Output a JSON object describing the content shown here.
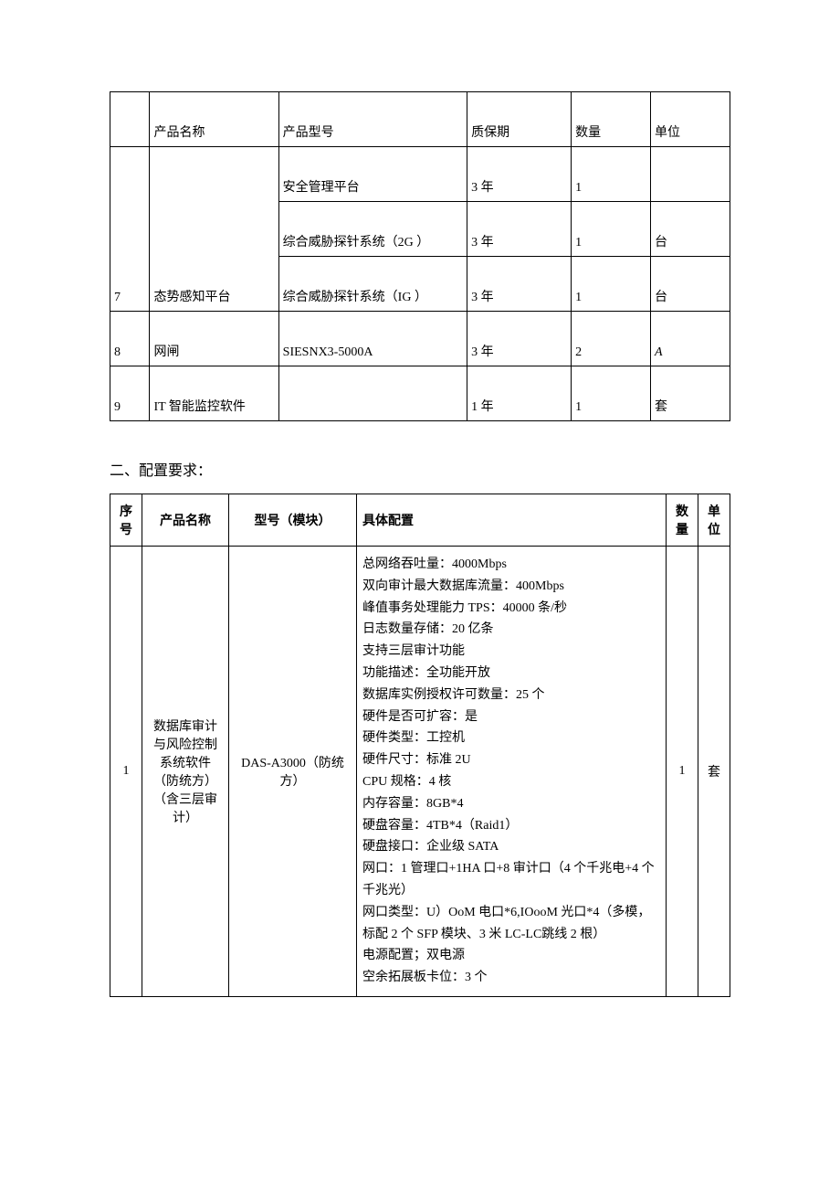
{
  "table1": {
    "headers": {
      "c0": "",
      "c1": "产品名称",
      "c2": "产品型号",
      "c3": "质保期",
      "c4": "数量",
      "c5": "单位"
    },
    "rows": [
      {
        "idx": "7",
        "name": "态势感知平台",
        "variants": [
          {
            "model": "安全管理平台",
            "warranty": "3 年",
            "qty": "1",
            "unit": ""
          },
          {
            "model": "综合威胁探针系统（2G ）",
            "warranty": "3 年",
            "qty": "1",
            "unit": "台"
          },
          {
            "model": "综合威胁探针系统（IG ）",
            "warranty": "3 年",
            "qty": "1",
            "unit": "台"
          }
        ]
      },
      {
        "idx": "8",
        "name": "网闸",
        "model": "SIESNX3-5000A",
        "warranty": "3 年",
        "qty": "2",
        "unit": "A"
      },
      {
        "idx": "9",
        "name": "IT 智能监控软件",
        "model": "",
        "warranty": "1 年",
        "qty": "1",
        "unit": "套"
      }
    ]
  },
  "section2": {
    "title": "二、配置要求：",
    "headers": {
      "c0": "序号",
      "c1": "产品名称",
      "c2": "型号（模块）",
      "c3": "具体配置",
      "c4": "数量",
      "c5": "单位"
    },
    "rows": [
      {
        "idx": "1",
        "name": "数据库审计与风险控制系统软件（防统方）（含三层审计）",
        "model": "DAS-A3000（防统方）",
        "spec": "总网络吞吐量：4000Mbps\n双向审计最大数据库流量：400Mbps\n峰值事务处理能力 TPS：40000 条/秒\n日志数量存储：20 亿条\n支持三层审计功能\n功能描述：全功能开放\n数据库实例授权许可数量：25 个\n硬件是否可扩容：是\n硬件类型：工控机\n硬件尺寸：标准 2U\nCPU 规格：4 核\n内存容量：8GB*4\n硬盘容量：4TB*4（Raid1）\n硬盘接口：企业级 SATA\n网口：1 管理口+1HA 口+8 审计口（4 个千兆电+4 个千兆光）\n网口类型：U）OoM 电口*6,IOooM 光口*4（多模，标配 2 个 SFP 模块、3 米 LC-LC跳线 2 根）\n电源配置；双电源\n空余拓展板卡位：3 个",
        "qty": "1",
        "unit": "套"
      }
    ]
  }
}
